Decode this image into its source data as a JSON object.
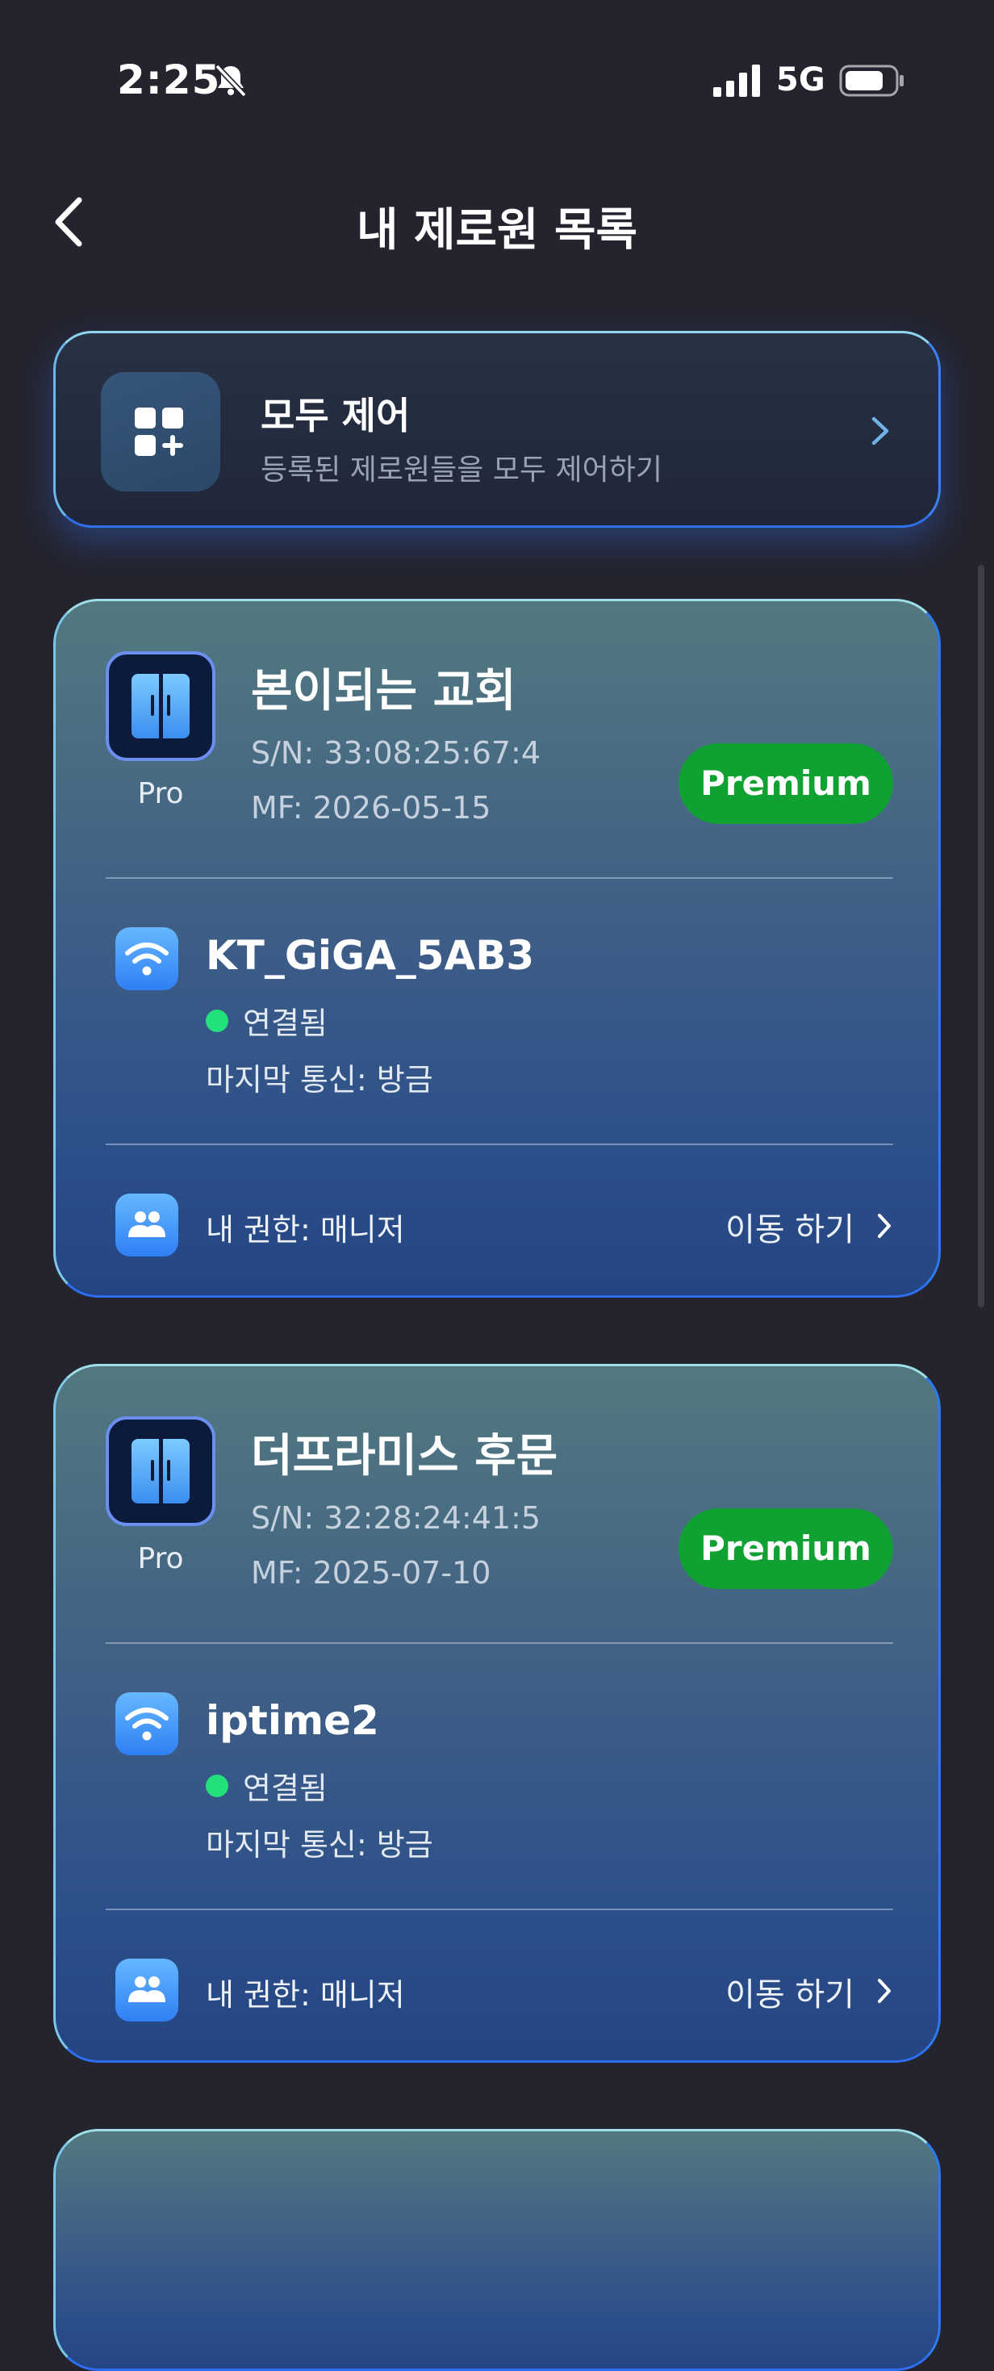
{
  "status_bar": {
    "time": "2:25",
    "network": "5G",
    "icons": [
      "bell-off-icon",
      "signal-icon",
      "battery-icon"
    ]
  },
  "nav": {
    "title": "내 제로원 목록",
    "back_icon": "chevron-left-icon"
  },
  "control_all": {
    "title": "모두 제어",
    "subtitle": "등록된 제로원들을 모두 제어하기",
    "icon": "grid-add-icon"
  },
  "devices": [
    {
      "name": "본이되는 교회",
      "type": "Pro",
      "serial": "S/N: 33:08:25:67:4",
      "manufactured": "MF: 2026-05-15",
      "plan": "Premium",
      "wifi_ssid": "KT_GiGA_5AB3",
      "connection_status": "연결됨",
      "last_communication": "마지막 통신: 방금",
      "role": "내 권한: 매니저",
      "action_label": "이동 하기"
    },
    {
      "name": "더프라미스 후문",
      "type": "Pro",
      "serial": "S/N: 32:28:24:41:5",
      "manufactured": "MF: 2025-07-10",
      "plan": "Premium",
      "wifi_ssid": "iptime2",
      "connection_status": "연결됨",
      "last_communication": "마지막 통신: 방금",
      "role": "내 권한: 매니저",
      "action_label": "이동 하기"
    }
  ],
  "colors": {
    "background": "#24242f",
    "premium_badge": "#0fa132",
    "connected_dot": "#22e07a",
    "accent_blue": "#2f7ff5"
  }
}
